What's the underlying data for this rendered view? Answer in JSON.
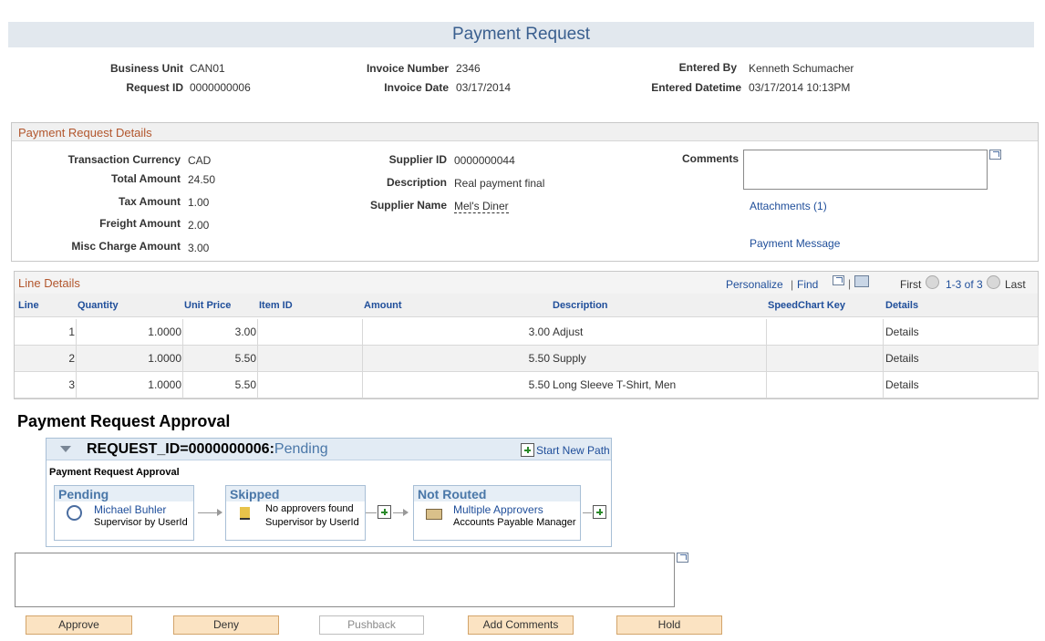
{
  "page": {
    "title": "Payment Request"
  },
  "header": {
    "business_unit_label": "Business Unit",
    "business_unit": "CAN01",
    "request_id_label": "Request ID",
    "request_id": "0000000006",
    "invoice_number_label": "Invoice Number",
    "invoice_number": "2346",
    "invoice_date_label": "Invoice Date",
    "invoice_date": "03/17/2014",
    "entered_by_label": "Entered By",
    "entered_by": "Kenneth Schumacher",
    "entered_datetime_label": "Entered Datetime",
    "entered_datetime": "03/17/2014 10:13PM"
  },
  "details": {
    "title": "Payment Request Details",
    "currency_label": "Transaction Currency",
    "currency": "CAD",
    "total_label": "Total Amount",
    "total": "24.50",
    "tax_label": "Tax Amount",
    "tax": "1.00",
    "freight_label": "Freight Amount",
    "freight": "2.00",
    "misc_label": "Misc Charge Amount",
    "misc": "3.00",
    "supplier_id_label": "Supplier ID",
    "supplier_id": "0000000044",
    "description_label": "Description",
    "description": "Real payment final",
    "supplier_name_label": "Supplier Name",
    "supplier_name": "Mel's Diner",
    "comments_label": "Comments",
    "comments": "",
    "attachments_link": "Attachments (1)",
    "payment_message_link": "Payment Message"
  },
  "lines": {
    "title": "Line Details",
    "personalize": "Personalize",
    "sep": "|",
    "find": "Find",
    "first": "First",
    "range": "1-3 of 3",
    "last": "Last",
    "columns": [
      "Line",
      "Quantity",
      "Unit Price",
      "Item ID",
      "Amount",
      "Description",
      "SpeedChart Key",
      "Details"
    ],
    "rows": [
      {
        "line": "1",
        "quantity": "1.0000",
        "unit_price": "3.00",
        "item_id": "",
        "amount": "3.00",
        "description": "Adjust",
        "speedchart": "",
        "details": "Details"
      },
      {
        "line": "2",
        "quantity": "1.0000",
        "unit_price": "5.50",
        "item_id": "",
        "amount": "5.50",
        "description": "Supply",
        "speedchart": "",
        "details": "Details"
      },
      {
        "line": "3",
        "quantity": "1.0000",
        "unit_price": "5.50",
        "item_id": "",
        "amount": "5.50",
        "description": "Long Sleeve T-Shirt, Men",
        "speedchart": "",
        "details": "Details"
      }
    ]
  },
  "approval": {
    "section_title": "Payment Request Approval",
    "request_label": "REQUEST_ID=0000000006:",
    "request_status": "Pending",
    "start_new_path": "Start New Path",
    "path_name": "Payment Request Approval",
    "stages": [
      {
        "status": "Pending",
        "line1": "Michael Buhler",
        "line2": "Supervisor by UserId"
      },
      {
        "status": "Skipped",
        "line1": "No approvers found",
        "line2": "Supervisor by UserId"
      },
      {
        "status": "Not Routed",
        "line1": "Multiple Approvers",
        "line2": "Accounts Payable Manager"
      }
    ],
    "approver_comments": ""
  },
  "buttons": {
    "approve": "Approve",
    "deny": "Deny",
    "pushback": "Pushback",
    "add_comments": "Add Comments",
    "hold": "Hold"
  }
}
